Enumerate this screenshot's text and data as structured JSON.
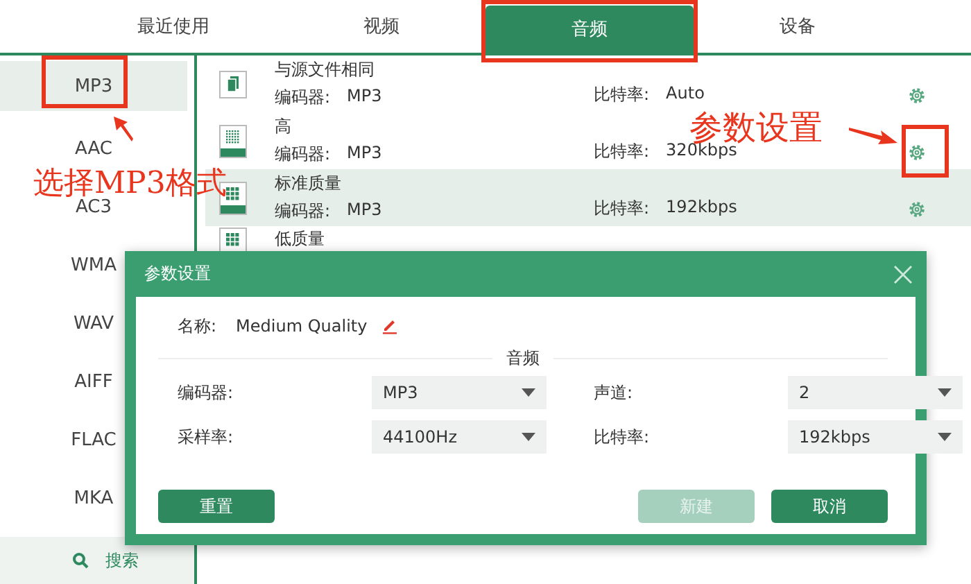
{
  "tabs": [
    {
      "label": "最近使用",
      "selected": false
    },
    {
      "label": "视频",
      "selected": false
    },
    {
      "label": "音频",
      "selected": true
    },
    {
      "label": "设备",
      "selected": false
    }
  ],
  "formats": [
    {
      "label": "MP3",
      "selected": true
    },
    {
      "label": "AAC",
      "selected": false
    },
    {
      "label": "AC3",
      "selected": false
    },
    {
      "label": "WMA",
      "selected": false
    },
    {
      "label": "WAV",
      "selected": false
    },
    {
      "label": "AIFF",
      "selected": false
    },
    {
      "label": "FLAC",
      "selected": false
    },
    {
      "label": "MKA",
      "selected": false
    }
  ],
  "search": {
    "label": "搜索"
  },
  "presets": [
    {
      "kind": "same",
      "name": "与源文件相同",
      "codec_label": "编码器:",
      "codec": "MP3",
      "bitrate_label": "比特率:",
      "bitrate": "Auto",
      "selected": false
    },
    {
      "kind": "high",
      "name": "高",
      "codec_label": "编码器:",
      "codec": "MP3",
      "bitrate_label": "比特率:",
      "bitrate": "320kbps",
      "selected": false
    },
    {
      "kind": "standard",
      "name": "标准质量",
      "codec_label": "编码器:",
      "codec": "MP3",
      "bitrate_label": "比特率:",
      "bitrate": "192kbps",
      "selected": true
    },
    {
      "kind": "low",
      "name": "低质量",
      "selected": false
    }
  ],
  "dialog": {
    "title": "参数设置",
    "name_label": "名称:",
    "name": "Medium Quality",
    "section": "音频",
    "fields": [
      {
        "label": "编码器:",
        "value": "MP3"
      },
      {
        "label": "声道:",
        "value": "2"
      },
      {
        "label": "采样率:",
        "value": "44100Hz"
      },
      {
        "label": "比特率:",
        "value": "192kbps"
      }
    ],
    "buttons": [
      {
        "label": "重置",
        "disabled": false
      },
      {
        "label": "新建",
        "disabled": true
      },
      {
        "label": "取消",
        "disabled": false
      }
    ]
  },
  "annotations": [
    {
      "text": "选择MP3格式"
    },
    {
      "text": "参数设置"
    }
  ]
}
